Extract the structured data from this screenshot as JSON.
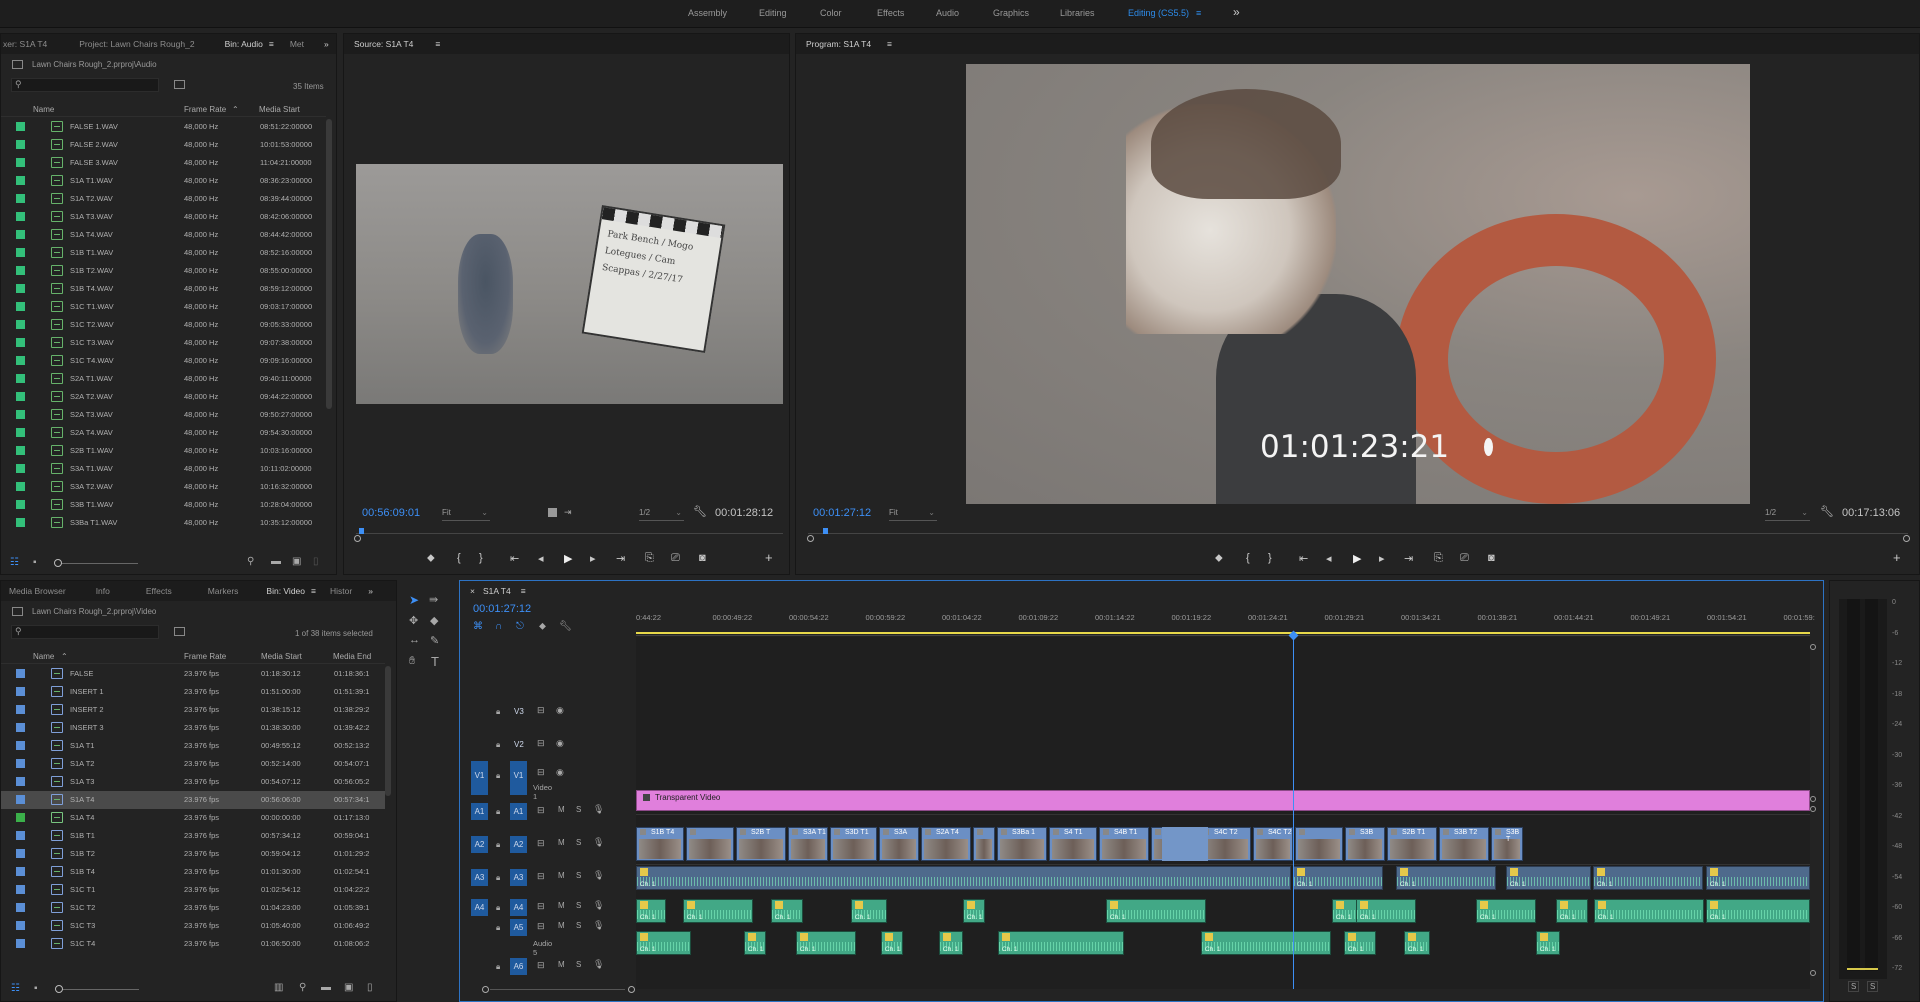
{
  "workspaces": [
    "Assembly",
    "Editing",
    "Color",
    "Effects",
    "Audio",
    "Graphics",
    "Libraries",
    "Editing (CS5.5)"
  ],
  "workspace_more": "»",
  "bin_audio_panel": {
    "tabs": [
      "xer: S1A T4",
      "Project: Lawn Chairs Rough_2",
      "Bin: Audio",
      "Met"
    ],
    "path": "Lawn Chairs Rough_2.prproj\\Audio",
    "count": "35 Items",
    "headers": {
      "name": "Name",
      "rate": "Frame Rate",
      "start": "Media Start"
    },
    "swatch_color": "#33c07a",
    "rows": [
      {
        "name": "FALSE 1.WAV",
        "rate": "48,000 Hz",
        "start": "08:51:22:00000"
      },
      {
        "name": "FALSE 2.WAV",
        "rate": "48,000 Hz",
        "start": "10:01:53:00000"
      },
      {
        "name": "FALSE 3.WAV",
        "rate": "48,000 Hz",
        "start": "11:04:21:00000"
      },
      {
        "name": "S1A T1.WAV",
        "rate": "48,000 Hz",
        "start": "08:36:23:00000"
      },
      {
        "name": "S1A T2.WAV",
        "rate": "48,000 Hz",
        "start": "08:39:44:00000"
      },
      {
        "name": "S1A T3.WAV",
        "rate": "48,000 Hz",
        "start": "08:42:06:00000"
      },
      {
        "name": "S1A T4.WAV",
        "rate": "48,000 Hz",
        "start": "08:44:42:00000"
      },
      {
        "name": "S1B T1.WAV",
        "rate": "48,000 Hz",
        "start": "08:52:16:00000"
      },
      {
        "name": "S1B T2.WAV",
        "rate": "48,000 Hz",
        "start": "08:55:00:00000"
      },
      {
        "name": "S1B T4.WAV",
        "rate": "48,000 Hz",
        "start": "08:59:12:00000"
      },
      {
        "name": "S1C T1.WAV",
        "rate": "48,000 Hz",
        "start": "09:03:17:00000"
      },
      {
        "name": "S1C T2.WAV",
        "rate": "48,000 Hz",
        "start": "09:05:33:00000"
      },
      {
        "name": "S1C T3.WAV",
        "rate": "48,000 Hz",
        "start": "09:07:38:00000"
      },
      {
        "name": "S1C T4.WAV",
        "rate": "48,000 Hz",
        "start": "09:09:16:00000"
      },
      {
        "name": "S2A T1.WAV",
        "rate": "48,000 Hz",
        "start": "09:40:11:00000"
      },
      {
        "name": "S2A T2.WAV",
        "rate": "48,000 Hz",
        "start": "09:44:22:00000"
      },
      {
        "name": "S2A T3.WAV",
        "rate": "48,000 Hz",
        "start": "09:50:27:00000"
      },
      {
        "name": "S2A T4.WAV",
        "rate": "48,000 Hz",
        "start": "09:54:30:00000"
      },
      {
        "name": "S2B T1.WAV",
        "rate": "48,000 Hz",
        "start": "10:03:16:00000"
      },
      {
        "name": "S3A T1.WAV",
        "rate": "48,000 Hz",
        "start": "10:11:02:00000"
      },
      {
        "name": "S3A T2.WAV",
        "rate": "48,000 Hz",
        "start": "10:16:32:00000"
      },
      {
        "name": "S3B T1.WAV",
        "rate": "48,000 Hz",
        "start": "10:28:04:00000"
      },
      {
        "name": "S3Ba T1.WAV",
        "rate": "48,000 Hz",
        "start": "10:35:12:00000"
      }
    ]
  },
  "source_monitor": {
    "tab": "Source: S1A T4",
    "timecode": "00:56:09:01",
    "fit": "Fit",
    "res": "1/2",
    "duration": "00:01:28:12",
    "slate_text": "Park Bench / Mogo Lotegues / Cam Scappas / 2/27/17"
  },
  "program_monitor": {
    "tab": "Program: S1A T4",
    "timecode": "00:01:27:12",
    "fit": "Fit",
    "res": "1/2",
    "duration": "00:17:13:06",
    "burn_in": "01:01:23:21"
  },
  "bin_video_panel": {
    "tabs": [
      "Media Browser",
      "Info",
      "Effects",
      "Markers",
      "Bin: Video",
      "Histor"
    ],
    "path": "Lawn Chairs Rough_2.prproj\\Video",
    "count": "1 of 38 items selected",
    "headers": {
      "name": "Name",
      "rate": "Frame Rate",
      "start": "Media Start",
      "end": "Media End"
    },
    "swatch_color": "#5b8fd6",
    "rows": [
      {
        "name": "FALSE",
        "rate": "23.976 fps",
        "start": "01:18:30:12",
        "end": "01:18:36:1"
      },
      {
        "name": "INSERT 1",
        "rate": "23.976 fps",
        "start": "01:51:00:00",
        "end": "01:51:39:1"
      },
      {
        "name": "INSERT 2",
        "rate": "23.976 fps",
        "start": "01:38:15:12",
        "end": "01:38:29:2"
      },
      {
        "name": "INSERT 3",
        "rate": "23.976 fps",
        "start": "01:38:30:00",
        "end": "01:39:42:2"
      },
      {
        "name": "S1A T1",
        "rate": "23.976 fps",
        "start": "00:49:55:12",
        "end": "00:52:13:2"
      },
      {
        "name": "S1A T2",
        "rate": "23.976 fps",
        "start": "00:52:14:00",
        "end": "00:54:07:1"
      },
      {
        "name": "S1A T3",
        "rate": "23.976 fps",
        "start": "00:54:07:12",
        "end": "00:56:05:2"
      },
      {
        "name": "S1A T4",
        "rate": "23.976 fps",
        "start": "00:56:06:00",
        "end": "00:57:34:1",
        "selected": true
      },
      {
        "name": "S1A T4",
        "rate": "23.976 fps",
        "start": "00:00:00:00",
        "end": "01:17:13:0",
        "sequence": true
      },
      {
        "name": "S1B T1",
        "rate": "23.976 fps",
        "start": "00:57:34:12",
        "end": "00:59:04:1"
      },
      {
        "name": "S1B T2",
        "rate": "23.976 fps",
        "start": "00:59:04:12",
        "end": "01:01:29:2"
      },
      {
        "name": "S1B T4",
        "rate": "23.976 fps",
        "start": "01:01:30:00",
        "end": "01:02:54:1"
      },
      {
        "name": "S1C T1",
        "rate": "23.976 fps",
        "start": "01:02:54:12",
        "end": "01:04:22:2"
      },
      {
        "name": "S1C T2",
        "rate": "23.976 fps",
        "start": "01:04:23:00",
        "end": "01:05:39:1"
      },
      {
        "name": "S1C T3",
        "rate": "23.976 fps",
        "start": "01:05:40:00",
        "end": "01:06:49:2"
      },
      {
        "name": "S1C T4",
        "rate": "23.976 fps",
        "start": "01:06:50:00",
        "end": "01:08:06:2"
      }
    ]
  },
  "timeline": {
    "tab": "S1A T4",
    "timecode": "00:01:27:12",
    "ruler": [
      "0:44:22",
      "00:00:49:22",
      "00:00:54:22",
      "00:00:59:22",
      "00:01:04:22",
      "00:01:09:22",
      "00:01:14:22",
      "00:01:19:22",
      "00:01:24:21",
      "00:01:29:21",
      "00:01:34:21",
      "00:01:39:21",
      "00:01:44:21",
      "00:01:49:21",
      "00:01:54:21",
      "00:01:59:"
    ],
    "tracks": {
      "v3": "V3",
      "v2": "V2",
      "v1": "V1",
      "v1_src": "V1",
      "v1_name": "Video 1",
      "a1": "A1",
      "a2": "A2",
      "a3": "A3",
      "a4": "A4",
      "a5": "A5",
      "a6": "A6",
      "a1_src": "A1",
      "a2_src": "A2",
      "a3_src": "A3",
      "a4_src": "A4",
      "a5_name": "Audio 5",
      "mute": "M",
      "solo": "S"
    },
    "transparent_video": "Transparent Video",
    "v1_clips": [
      "S1B T4",
      "",
      "S2B T",
      "S3A T1",
      "S3D T1",
      "S3A",
      "S2A T4",
      "",
      "S3Ba 1",
      "S4 T1",
      "S4B T1",
      "",
      "S4C T2",
      "S4C T2",
      "",
      "S3B",
      "S2B T1",
      "S3B T2",
      "S3B T"
    ],
    "audio_clip_label": "Ch. 1"
  },
  "meters": {
    "scale": [
      "0",
      "-6",
      "-12",
      "-18",
      "-24",
      "-30",
      "-36",
      "-42",
      "-48",
      "-54",
      "-60",
      "-66",
      "-72"
    ],
    "solo": "S",
    "solo2": "S"
  }
}
